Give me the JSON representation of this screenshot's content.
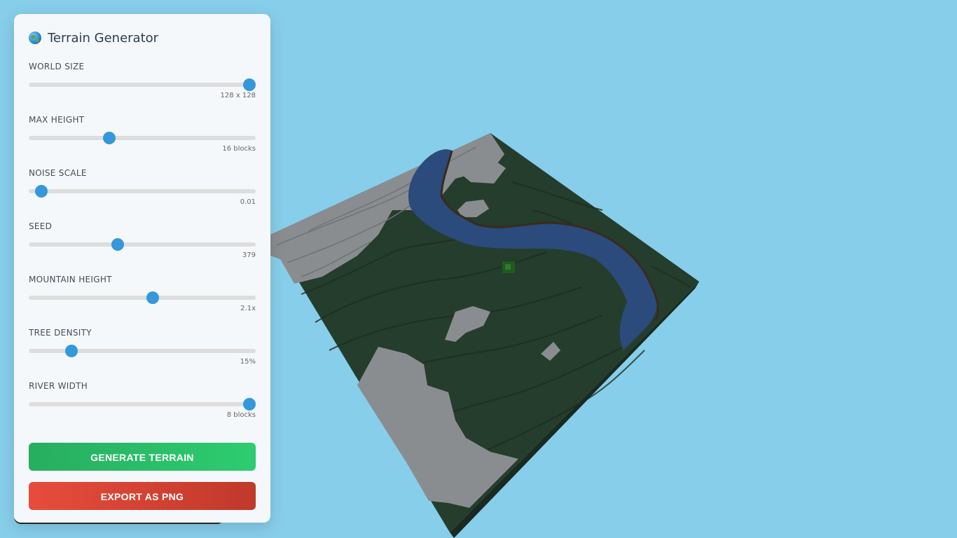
{
  "panel": {
    "title": "Terrain Generator",
    "title_icon": "globe-icon",
    "controls": [
      {
        "label": "WORLD SIZE",
        "value_text": "128 x 128",
        "fraction": 1.0
      },
      {
        "label": "MAX HEIGHT",
        "value_text": "16 blocks",
        "fraction": 0.345
      },
      {
        "label": "NOISE SCALE",
        "value_text": "0.01",
        "fraction": 0.03
      },
      {
        "label": "SEED",
        "value_text": "379",
        "fraction": 0.387
      },
      {
        "label": "MOUNTAIN HEIGHT",
        "value_text": "2.1x",
        "fraction": 0.55
      },
      {
        "label": "TREE DENSITY",
        "value_text": "15%",
        "fraction": 0.17
      },
      {
        "label": "RIVER WIDTH",
        "value_text": "8 blocks",
        "fraction": 1.0
      }
    ],
    "generate_label": "GENERATE TERRAIN",
    "export_label": "EXPORT AS PNG"
  },
  "colors": {
    "sky": "#87ceeb",
    "accent": "#3498db",
    "grass": "#253d2c",
    "stone": "#8a8d90",
    "water": "#2a4b7c",
    "generate": "#2ecc71",
    "export": "#e74c3c"
  }
}
